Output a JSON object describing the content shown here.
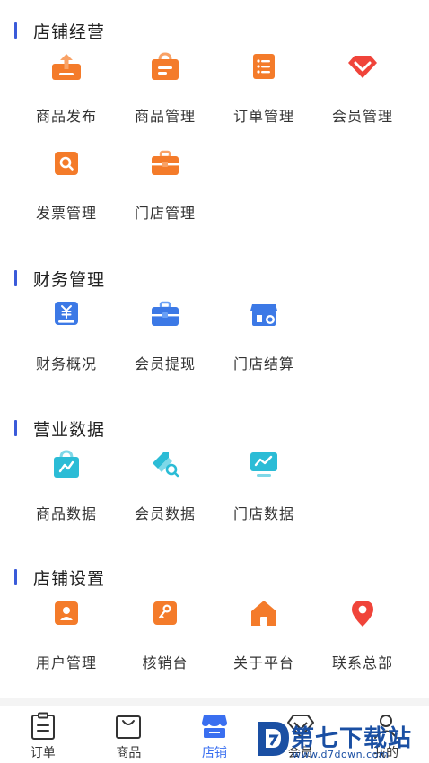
{
  "sections": [
    {
      "title": "店铺经营",
      "items": [
        {
          "label": "商品发布",
          "icon": "upload-box-icon"
        },
        {
          "label": "商品管理",
          "icon": "shopping-bag-icon"
        },
        {
          "label": "订单管理",
          "icon": "order-list-icon"
        },
        {
          "label": "会员管理",
          "icon": "diamond-icon"
        },
        {
          "label": "发票管理",
          "icon": "invoice-search-icon"
        },
        {
          "label": "门店管理",
          "icon": "briefcase-icon"
        }
      ]
    },
    {
      "title": "财务管理",
      "items": [
        {
          "label": "财务概况",
          "icon": "yuan-wallet-icon"
        },
        {
          "label": "会员提现",
          "icon": "toolbox-icon"
        },
        {
          "label": "门店结算",
          "icon": "store-settle-icon"
        }
      ]
    },
    {
      "title": "营业数据",
      "items": [
        {
          "label": "商品数据",
          "icon": "bag-chart-icon"
        },
        {
          "label": "会员数据",
          "icon": "tag-search-icon"
        },
        {
          "label": "门店数据",
          "icon": "monitor-chart-icon"
        }
      ]
    },
    {
      "title": "店铺设置",
      "items": [
        {
          "label": "用户管理",
          "icon": "user-card-icon"
        },
        {
          "label": "核销台",
          "icon": "key-card-icon"
        },
        {
          "label": "关于平台",
          "icon": "home-icon"
        },
        {
          "label": "联系总部",
          "icon": "location-pin-icon"
        }
      ]
    }
  ],
  "tabbar": [
    {
      "label": "订单",
      "icon": "clipboard-icon",
      "active": false
    },
    {
      "label": "商品",
      "icon": "bag-outline-icon",
      "active": false
    },
    {
      "label": "店铺",
      "icon": "store-icon",
      "active": true
    },
    {
      "label": "会员",
      "icon": "member-icon",
      "active": false
    },
    {
      "label": "我的",
      "icon": "profile-icon",
      "active": false
    }
  ],
  "watermark": {
    "main": "第七下载站",
    "url": "www.d7down.com"
  },
  "colors": {
    "accent": "#3a5bd9",
    "orange": "#f47b2a",
    "red": "#f0443a",
    "blue": "#3c79e6",
    "teal": "#2bbcd6",
    "tab_active": "#3a6ff0"
  }
}
